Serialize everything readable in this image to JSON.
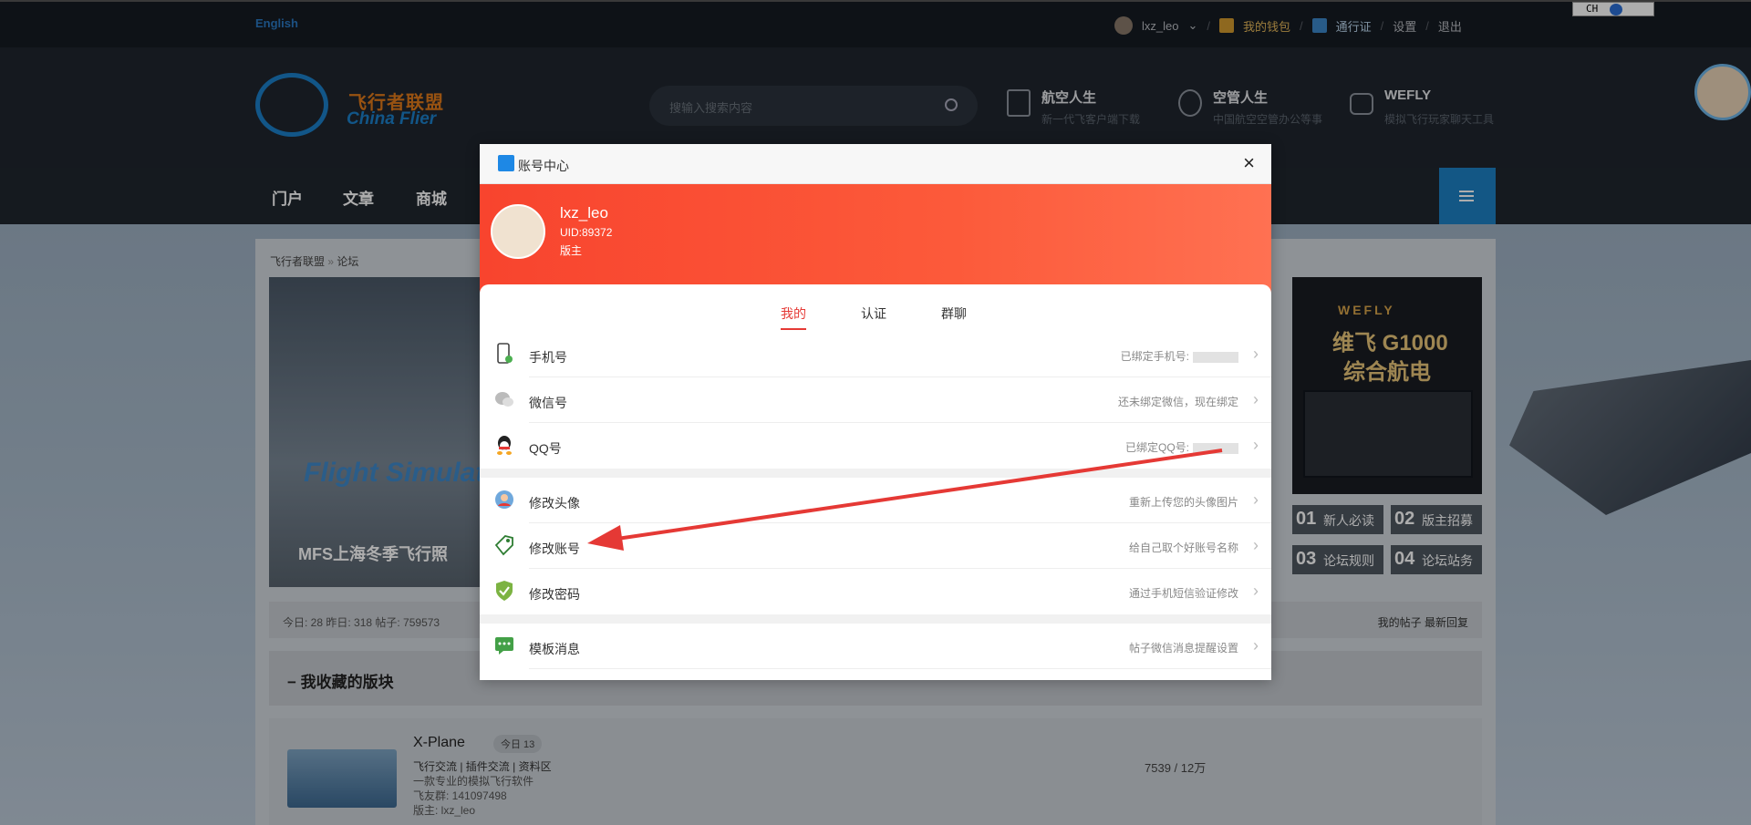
{
  "topbar": {
    "english": "English",
    "user": "lxz_leo",
    "wallet": "我的钱包",
    "pass": "通行证",
    "settings": "设置",
    "logout": "退出",
    "sep": "/",
    "ime": "CH"
  },
  "header": {
    "logo_cn": "飞行者联盟",
    "logo_en": "China Flier",
    "search_placeholder": "搜输入搜索内容",
    "cols": [
      {
        "title": "航空人生",
        "sub": "新一代飞客户端下载"
      },
      {
        "title": "空管人生",
        "sub": "中国航空空管办公等事"
      },
      {
        "title": "WEFLY",
        "sub": "模拟飞行玩家聊天工具"
      }
    ]
  },
  "nav": {
    "items": [
      "门户",
      "文章",
      "商城"
    ]
  },
  "content": {
    "breadcrumb": [
      "飞行者联盟",
      "论坛"
    ],
    "banner_caption": "MFS上海冬季飞行照",
    "banner_brand": "Flight Simulator",
    "ad": {
      "brand": "WEFLY",
      "line1": "维飞 G1000",
      "line2": "综合航电"
    },
    "tiles": [
      {
        "num": "01",
        "label": "新人必读"
      },
      {
        "num": "02",
        "label": "版主招募"
      },
      {
        "num": "03",
        "label": "论坛规则"
      },
      {
        "num": "04",
        "label": "论坛站务"
      }
    ],
    "stats_left": "今日: 28   昨日: 318   帖子: 759573",
    "stats_right": "我的帖子   最新回复",
    "fav_title": "我收藏的版块",
    "forum": {
      "name": "X-Plane",
      "today": "今日  13",
      "line1": "飞行交流 | 插件交流 |  资料区",
      "line2": "一款专业的模拟飞行软件",
      "line3": "飞友群: 141097498",
      "line4": "版主: lxz_leo",
      "count": "7539 / 12万"
    }
  },
  "modal": {
    "title": "账号中心",
    "close": "×",
    "profile": {
      "name": "lxz_leo",
      "uid": "UID:89372",
      "role": "版主"
    },
    "tabs": [
      "我的",
      "认证",
      "群聊"
    ],
    "rows": [
      {
        "label": "手机号",
        "value": "已绑定手机号:"
      },
      {
        "label": "微信号",
        "value": "还未绑定微信，现在绑定"
      },
      {
        "label": "QQ号",
        "value": "已绑定QQ号:"
      },
      {
        "label": "修改头像",
        "value": "重新上传您的头像图片"
      },
      {
        "label": "修改账号",
        "value": "给自己取个好账号名称"
      },
      {
        "label": "修改密码",
        "value": "通过手机短信验证修改"
      },
      {
        "label": "模板消息",
        "value": "帖子微信消息提醒设置"
      }
    ],
    "chevron": "›"
  },
  "colors": {
    "accent_red": "#f8442e",
    "brand_blue": "#1d81c4",
    "arrow": "#e53935"
  }
}
